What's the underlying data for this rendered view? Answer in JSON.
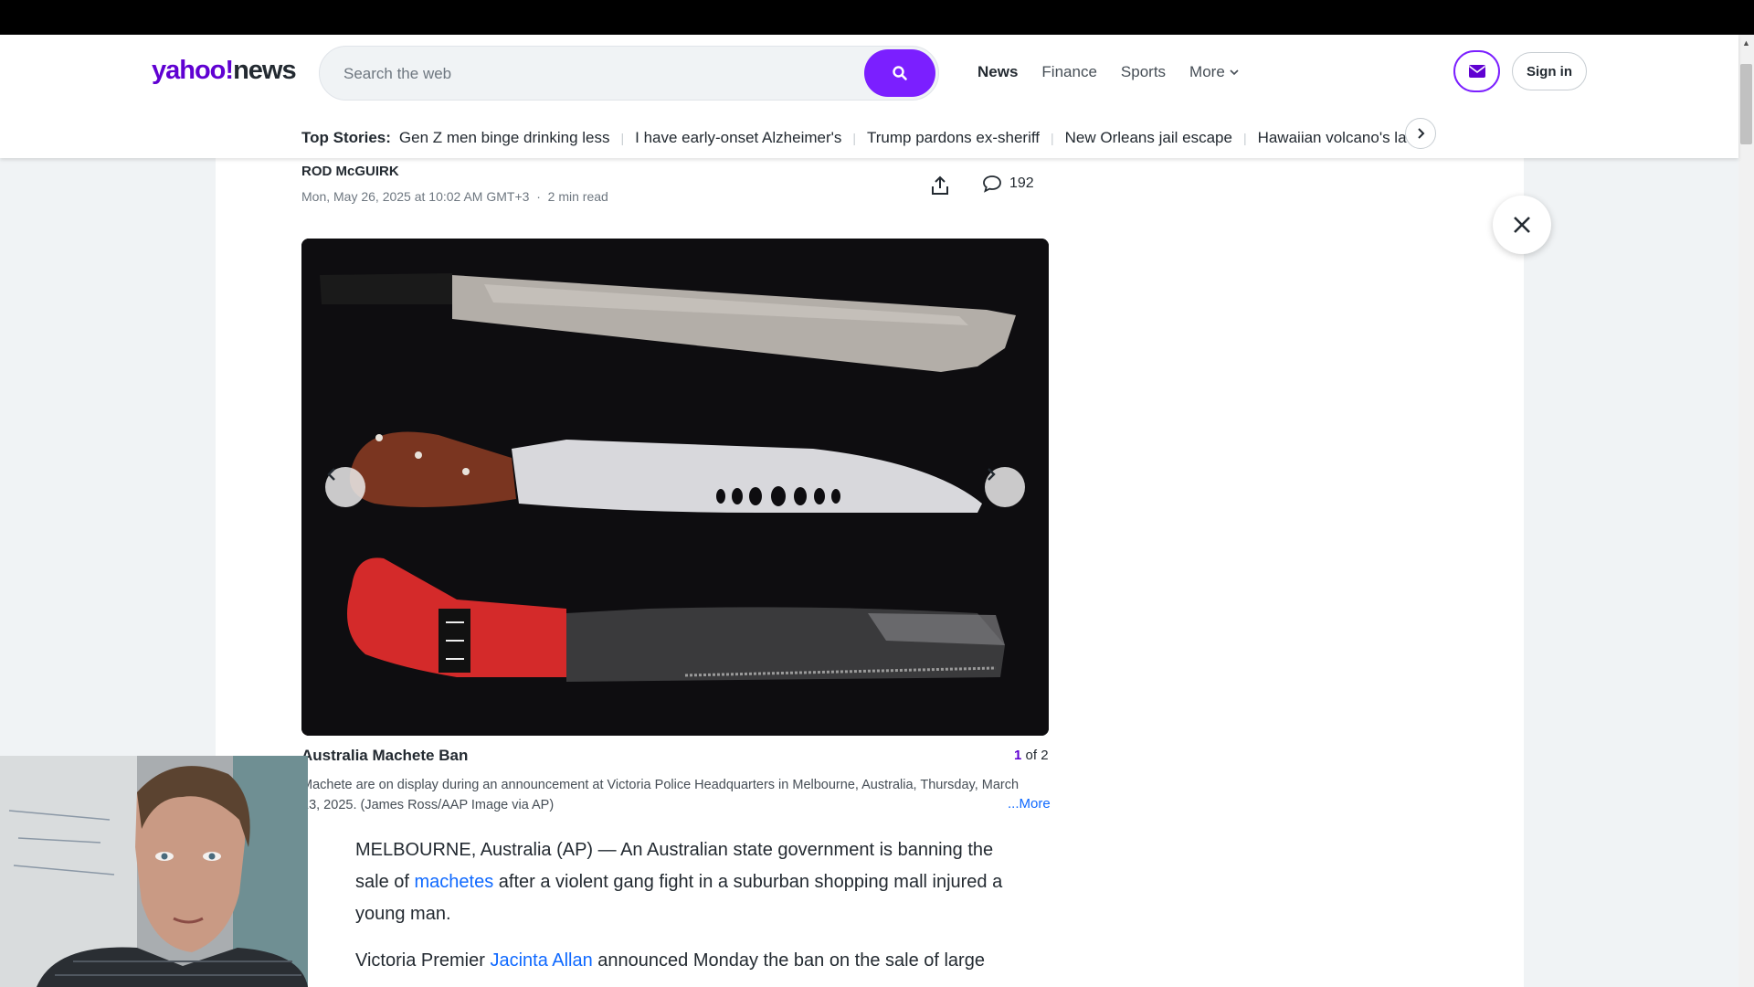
{
  "header": {
    "logo_text": "yahoo!",
    "logo_suffix": "news",
    "search_placeholder": "Search the web",
    "nav": [
      "News",
      "Finance",
      "Sports",
      "More"
    ],
    "sign_in": "Sign in"
  },
  "top_stories": {
    "label": "Top Stories:",
    "items": [
      "Gen Z men binge drinking less",
      "I have early-onset Alzheimer's",
      "Trump pardons ex-sheriff",
      "New Orleans jail escape"
    ],
    "truncated": "Hawaiian volcano's la"
  },
  "article": {
    "author": "ROD McGUIRK",
    "date": "Mon, May 26, 2025 at 10:02 AM GMT+3",
    "dot": "·",
    "read_time": "2 min read",
    "comment_count": "192"
  },
  "gallery": {
    "title": "Australia Machete Ban",
    "current": "1",
    "of_total": "of 2",
    "caption": "Machete are on display during an announcement at Victoria Police Headquarters in Melbourne, Australia, Thursday, March 13, 2025. (James Ross/AAP Image via AP)",
    "more": "...More"
  },
  "body": {
    "p1_a": "MELBOURNE, Australia (AP) — An Australian state government is banning the sale of ",
    "p1_link": "machetes",
    "p1_b": " after a violent gang fight in a suburban shopping mall injured a young man.",
    "p2_a": "Victoria Premier ",
    "p2_link": "Jacinta Allan",
    "p2_b": " announced Monday the ban on the sale of large"
  },
  "colors": {
    "brand_purple": "#6001d2",
    "search_button": "#7b1fff",
    "link_blue": "#0f69ff"
  }
}
